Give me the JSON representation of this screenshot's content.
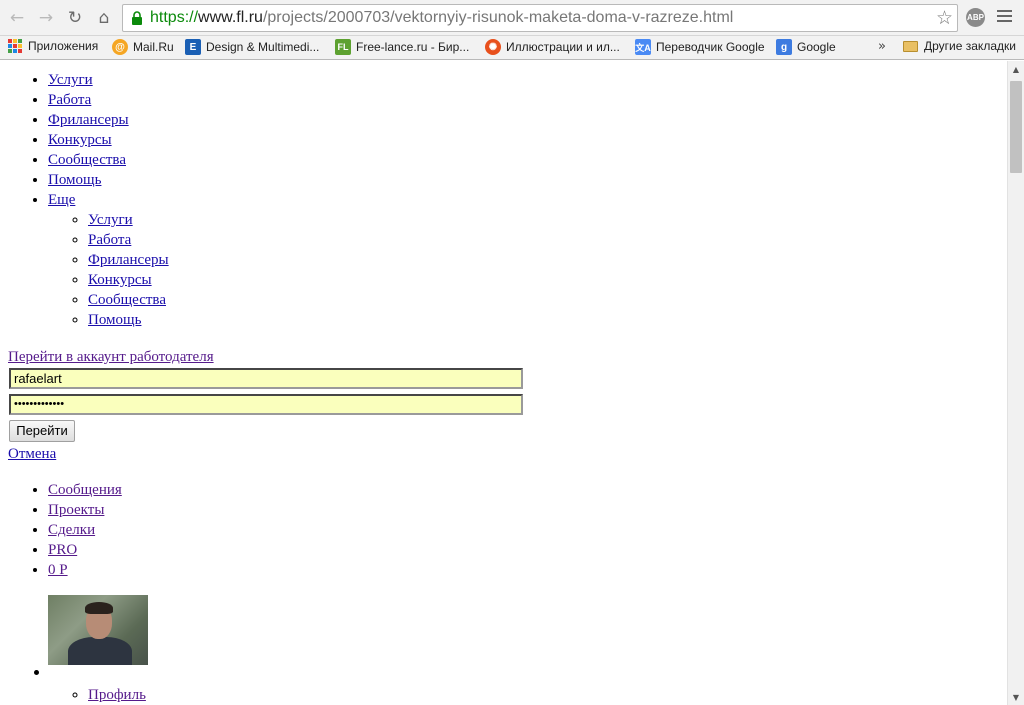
{
  "browser": {
    "url_scheme": "https://",
    "url_host": "www.fl.ru",
    "url_path": "/projects/2000703/vektornyiy-risunok-maketa-doma-v-razreze.html",
    "abp_label": "ABP"
  },
  "bookmarks": {
    "apps": "Приложения",
    "items": [
      {
        "label": "Mail.Ru",
        "icon": "mailru-icon",
        "color": "#f5a623"
      },
      {
        "label": "Design & Multimedi...",
        "icon": "e-icon",
        "color": "#1a5fb4"
      },
      {
        "label": "Free-lance.ru - Бир...",
        "icon": "fl-icon",
        "color": "#5da130"
      },
      {
        "label": "Иллюстрации и ил...",
        "icon": "splash-icon",
        "color": "#e8501c"
      },
      {
        "label": "Переводчик Google",
        "icon": "translate-icon",
        "color": "#4a8af4"
      },
      {
        "label": "Google",
        "icon": "google-icon",
        "color": "#3d7be0"
      }
    ],
    "overflow": "»",
    "other": "Другие закладки"
  },
  "nav": {
    "items": [
      "Услуги",
      "Работа",
      "Фрилансеры",
      "Конкурсы",
      "Сообщества",
      "Помощь",
      "Еще"
    ],
    "sub_items": [
      "Услуги",
      "Работа",
      "Фрилансеры",
      "Конкурсы",
      "Сообщества",
      "Помощь"
    ]
  },
  "login": {
    "switch_link": "Перейти в аккаунт работодателя",
    "username": "rafaelart",
    "password_mask": "•••••••••••••",
    "submit": "Перейти",
    "cancel": "Отмена"
  },
  "user_menu": {
    "items": [
      "Сообщения",
      "Проекты",
      "Сделки",
      "PRO",
      "0 Р"
    ],
    "profile": "Профиль"
  }
}
